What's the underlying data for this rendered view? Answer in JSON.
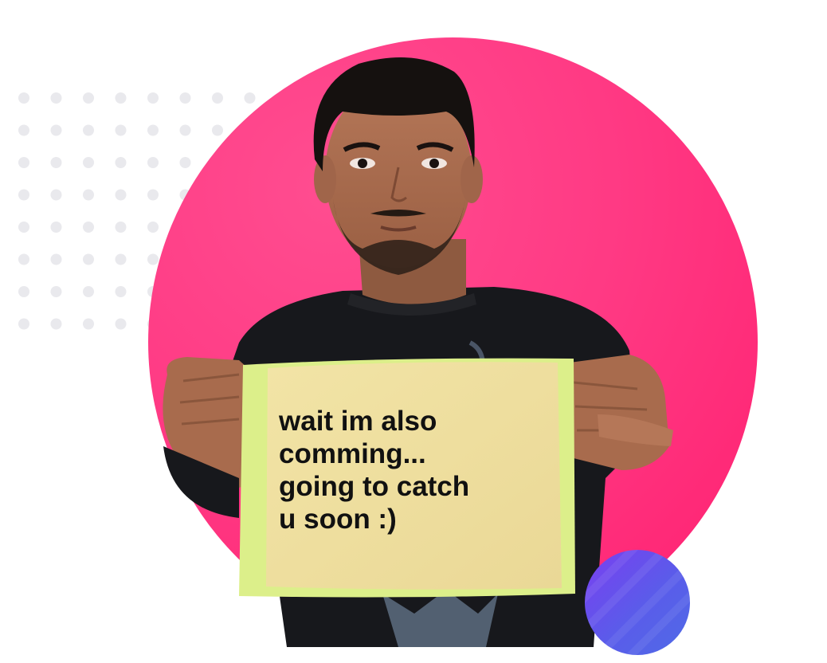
{
  "colors": {
    "background": "#ffffff",
    "dot": "#e9e9ed",
    "circle_gradient_start": "#ff4a8e",
    "circle_gradient_end": "#ff1c6c",
    "accent_gradient_start": "#7a3ff0",
    "accent_gradient_end": "#4f6be6",
    "sign_paper": "#efe09e",
    "sign_edge": "#dcef8a",
    "shirt": "#17181c",
    "skin": "#a86b4d",
    "hair": "#15110f"
  },
  "photo": {
    "subject": "man holding a handwritten paper sign",
    "sign_lines": [
      "wait im also",
      "comming...",
      "going to catch",
      "u soon :)"
    ]
  }
}
